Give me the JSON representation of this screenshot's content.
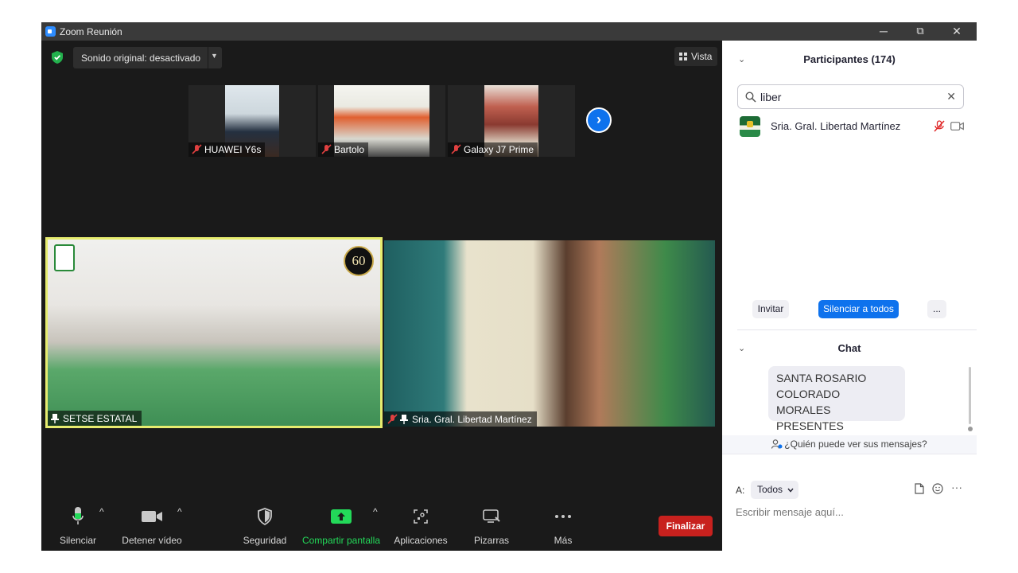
{
  "window": {
    "title": "Zoom Reunión",
    "minimize": "─",
    "restore": "⧉",
    "close": "✕"
  },
  "stage": {
    "sound_button": "Sonido original: desactivado",
    "sound_chevron": "▼",
    "view_button": "Vista",
    "thumbnails": [
      {
        "name": "HUAWEI Y6s"
      },
      {
        "name": "Bartolo"
      },
      {
        "name": "Galaxy J7 Prime"
      }
    ],
    "next_arrow": "›",
    "tiles": [
      {
        "name": "SETSE ESTATAL"
      },
      {
        "name": "Sria. Gral. Libertad Martínez"
      }
    ]
  },
  "toolbar": {
    "mute": "Silenciar",
    "stop_video": "Detener vídeo",
    "security": "Seguridad",
    "share_screen": "Compartir pantalla",
    "apps": "Aplicaciones",
    "whiteboards": "Pizarras",
    "more": "Más",
    "end": "Finalizar",
    "caret": "^"
  },
  "participants": {
    "header": "Participantes (174)",
    "search_value": "liber",
    "clear": "✕",
    "list": [
      {
        "name": "Sria. Gral. Libertad Martínez"
      }
    ],
    "invite": "Invitar",
    "mute_all": "Silenciar a todos",
    "more": "..."
  },
  "chat": {
    "header": "Chat",
    "messages": [
      {
        "line1": "SANTA ROSARIO",
        "line2": "COLORADO MORALES",
        "line3": "PRESENTES"
      }
    ],
    "who_can_see": "¿Quién puede ver sus mensajes?",
    "to_label": "A:",
    "to_value": "Todos",
    "input_placeholder": "Escribir mensaje aquí...",
    "more": "···"
  },
  "colors": {
    "zoom_blue": "#0e72ed",
    "end_red": "#c8211e",
    "share_green": "#23d959",
    "active_speaker": "#e6ec6f"
  }
}
